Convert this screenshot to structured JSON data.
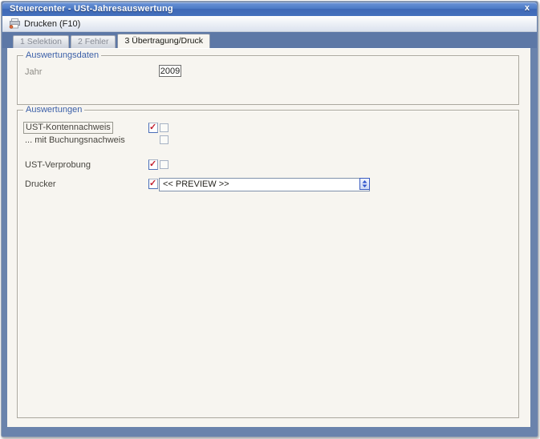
{
  "window": {
    "title": "Steuercenter - USt-Jahresauswertung",
    "close": "x"
  },
  "toolbar": {
    "print": "Drucken (F10)"
  },
  "tabs": [
    {
      "label": "1 Selektion",
      "active": false
    },
    {
      "label": "2 Fehler",
      "active": false
    },
    {
      "label": "3 Übertragung/Druck",
      "active": true
    }
  ],
  "auswertungsdaten": {
    "legend": "Auswertungsdaten",
    "jahr_label": "Jahr",
    "jahr_value": "2009"
  },
  "auswertungen": {
    "legend": "Auswertungen",
    "kontennachweis_label": "UST-Kontennachweis",
    "buchungsnachweis_label": "... mit Buchungsnachweis",
    "verprobung_label": "UST-Verprobung",
    "drucker_label": "Drucker",
    "drucker_value": "<< PREVIEW >>"
  },
  "states": {
    "kontennachweis_checked": true,
    "kontennachweis_extra_checked": false,
    "buchungsnachweis_checked": false,
    "verprobung_checked": true,
    "verprobung_extra_checked": false,
    "drucker_checked": true
  },
  "colors": {
    "titlebar_top": "#6e95d8",
    "titlebar_bottom": "#4470bd",
    "frame_blue": "#6a83ac",
    "tabstrip_blue": "#5d78a6",
    "content_bg": "#f7f5f0",
    "legend_blue": "#3c60a8",
    "check_red": "#c11f2e",
    "combo_button_border": "#3a5cc0"
  }
}
